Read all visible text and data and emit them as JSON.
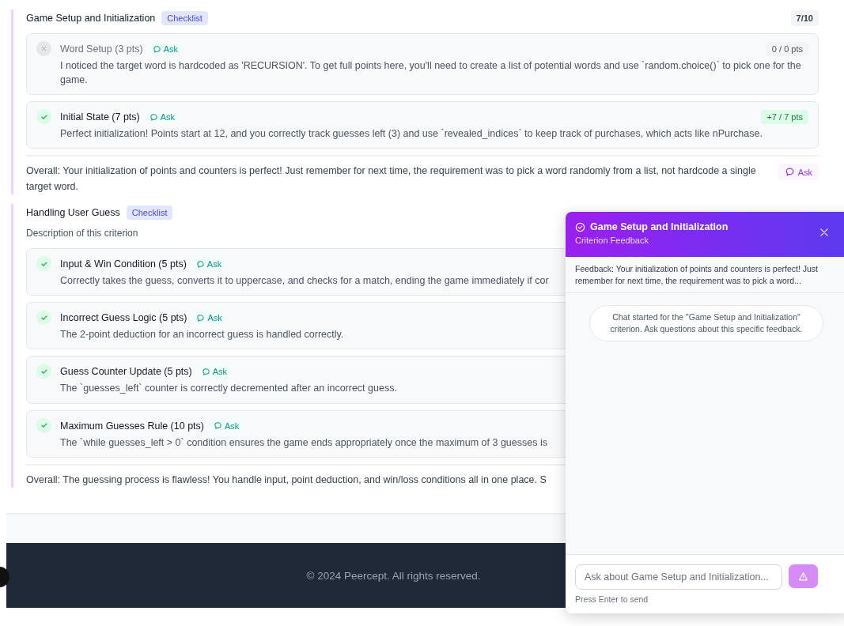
{
  "sections": [
    {
      "title": "Game Setup and Initialization",
      "tag": "Checklist",
      "score": "7/10",
      "items": [
        {
          "title": "Word Setup (3 pts)",
          "ask": "Ask",
          "passed": false,
          "points": "0 / 0 pts",
          "text": "I noticed the target word is hardcoded as 'RECURSION'. To get full points here, you'll need to create a list of potential words and use `random.choice()` to pick one for the game."
        },
        {
          "title": "Initial State (7 pts)",
          "ask": "Ask",
          "passed": true,
          "points": "+7 / 7 pts",
          "text": "Perfect initialization! Points start at 12, and you correctly track guesses left (3) and use `revealed_indices` to keep track of purchases, which acts like nPurchase."
        }
      ],
      "overall": "Overall: Your initialization of points and counters is perfect! Just remember for next time, the requirement was to pick a word randomly from a list, not hardcode a single target word.",
      "overall_ask": "Ask"
    },
    {
      "title": "Handling User Guess",
      "tag": "Checklist",
      "description": "Description of this criterion",
      "items": [
        {
          "title": "Input & Win Condition (5 pts)",
          "ask": "Ask",
          "passed": true,
          "text": "Correctly takes the guess, converts it to uppercase, and checks for a match, ending the game immediately if cor"
        },
        {
          "title": "Incorrect Guess Logic (5 pts)",
          "ask": "Ask",
          "passed": true,
          "text": "The 2-point deduction for an incorrect guess is handled correctly."
        },
        {
          "title": "Guess Counter Update (5 pts)",
          "ask": "Ask",
          "passed": true,
          "text": "The `guesses_left` counter is correctly decremented after an incorrect guess."
        },
        {
          "title": "Maximum Guesses Rule (10 pts)",
          "ask": "Ask",
          "passed": true,
          "text": "The `while guesses_left > 0` condition ensures the game ends appropriately once the maximum of 3 guesses is"
        }
      ],
      "overall": "Overall: The guessing process is flawless! You handle input, point deduction, and win/loss conditions all in one place. S"
    }
  ],
  "footer": "© 2024 Peercept. All rights reserved.",
  "chat": {
    "title": "Game Setup and Initialization",
    "subtitle": "Criterion Feedback",
    "feedback": "Feedback: Your initialization of points and counters is perfect! Just remember for next time, the requirement was to pick a word...",
    "message": "Chat started for the \"Game Setup and Initialization\" criterion. Ask questions about this specific feedback.",
    "placeholder": "Ask about Game Setup and Initialization...",
    "hint": "Press Enter to send"
  }
}
